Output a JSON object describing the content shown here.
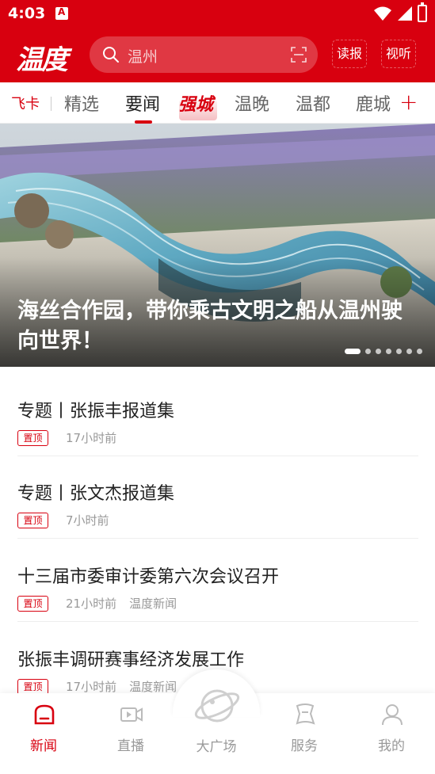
{
  "status_bar": {
    "time": "4:03"
  },
  "header": {
    "logo": "温度",
    "search_placeholder": "温州",
    "read_button": "读报",
    "watch_button": "视听"
  },
  "tabs": {
    "feika": "飞卡",
    "items": [
      "精选",
      "要闻",
      "温晚",
      "温都",
      "鹿城"
    ],
    "active": "要闻",
    "special": "强城",
    "plus": "+"
  },
  "hero": {
    "caption": "海丝合作园，带你乘古文明之船从温州驶向世界！"
  },
  "news": [
    {
      "title": "专题丨张振丰报道集",
      "badge": "置顶",
      "time": "17小时前",
      "source": ""
    },
    {
      "title": "专题丨张文杰报道集",
      "badge": "置顶",
      "time": "7小时前",
      "source": ""
    },
    {
      "title": "十三届市委审计委第六次会议召开",
      "badge": "置顶",
      "time": "21小时前",
      "source": "温度新闻"
    },
    {
      "title": "张振丰调研赛事经济发展工作",
      "badge": "置顶",
      "time": "17小时前",
      "source": "温度新闻"
    }
  ],
  "bottom_nav": {
    "news": "新闻",
    "live": "直播",
    "plaza": "大广场",
    "service": "服务",
    "mine": "我的"
  },
  "colors": {
    "brand_red": "#d8000f"
  }
}
